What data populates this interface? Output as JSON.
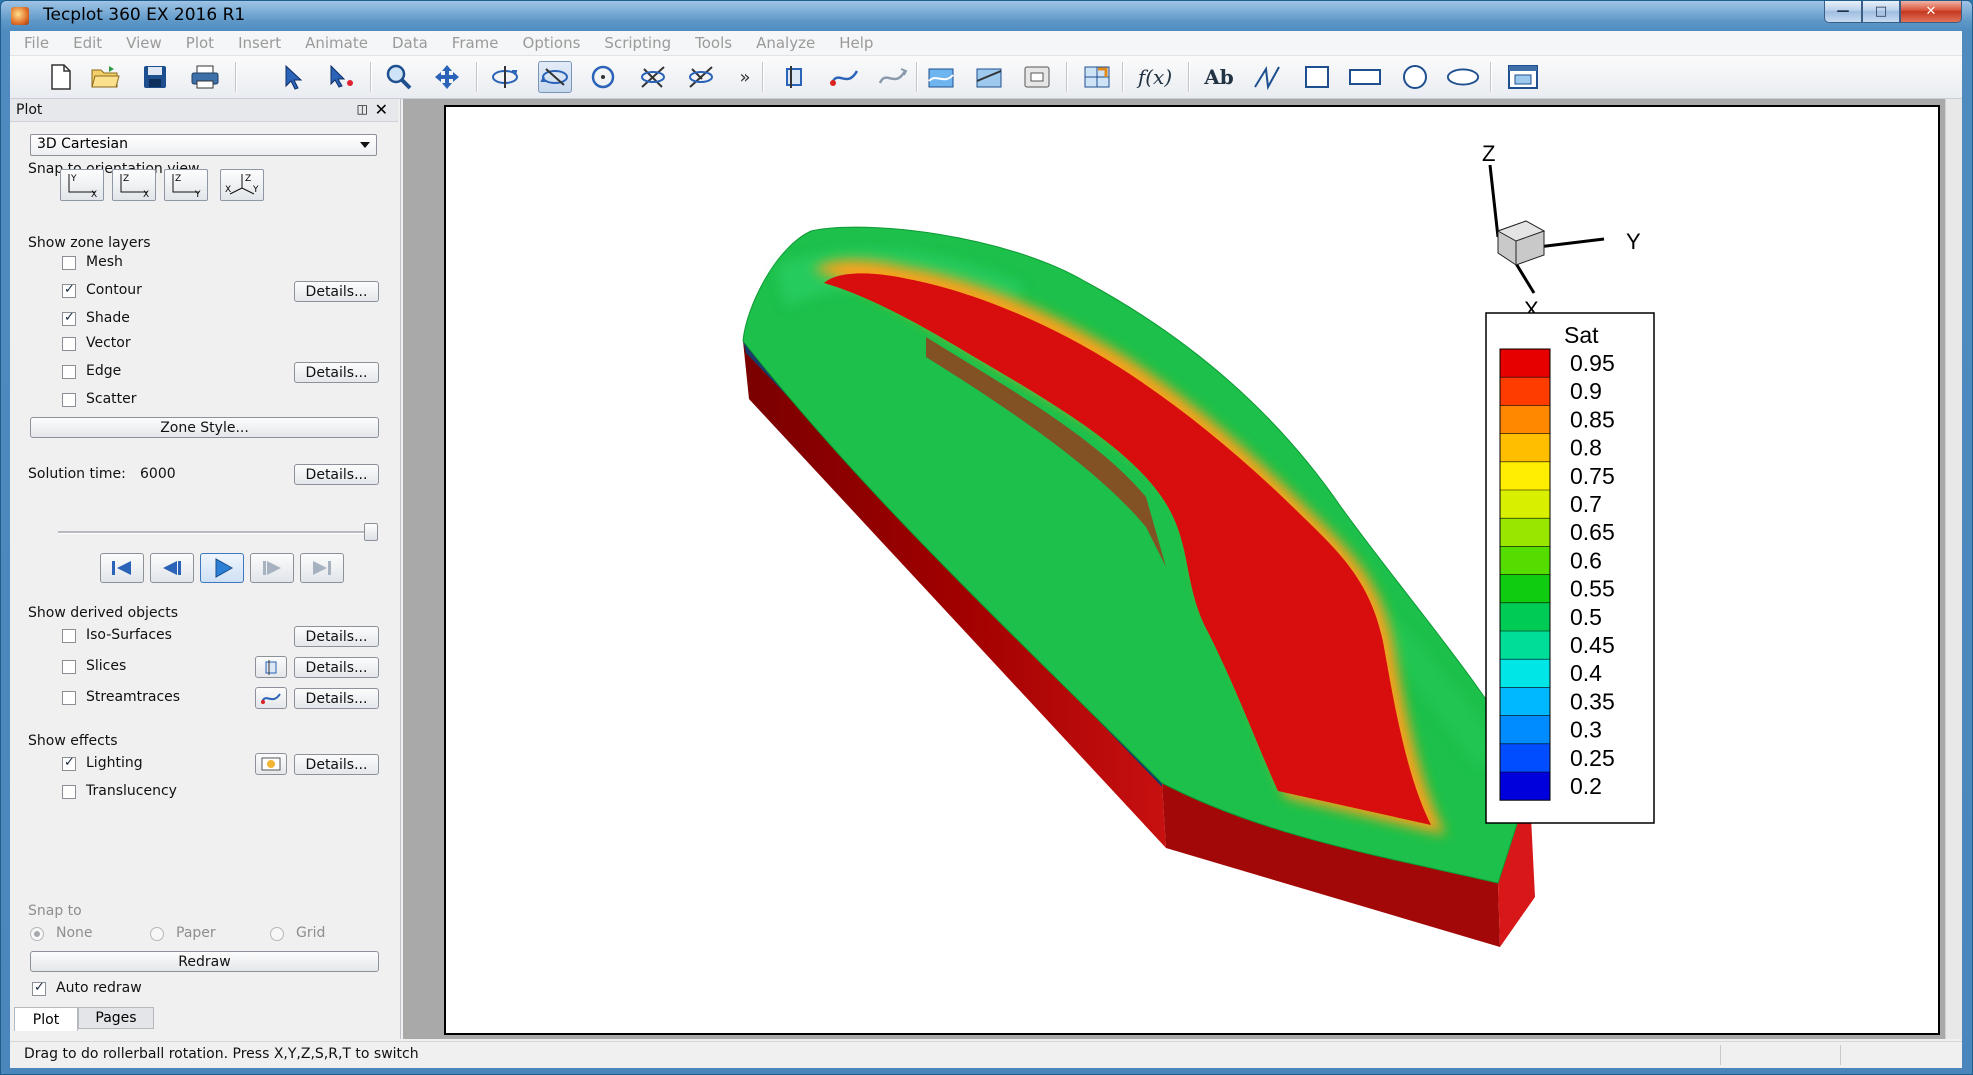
{
  "window": {
    "title": "Tecplot 360 EX 2016 R1"
  },
  "menubar": [
    "File",
    "Edit",
    "View",
    "Plot",
    "Insert",
    "Animate",
    "Data",
    "Frame",
    "Options",
    "Scripting",
    "Tools",
    "Analyze",
    "Help"
  ],
  "toolbar": {
    "overflow_label": "»",
    "text_tool_label": "Ab",
    "function_label": "f(x)"
  },
  "panel": {
    "title": "Plot",
    "plot_type": "3D Cartesian",
    "snap_orientation_label": "Snap to orientation view",
    "show_zone_layers_label": "Show zone layers",
    "layers": [
      {
        "label": "Mesh",
        "checked": false,
        "details": false
      },
      {
        "label": "Contour",
        "checked": true,
        "details": true
      },
      {
        "label": "Shade",
        "checked": true,
        "details": false
      },
      {
        "label": "Vector",
        "checked": false,
        "details": false
      },
      {
        "label": "Edge",
        "checked": false,
        "details": true
      },
      {
        "label": "Scatter",
        "checked": false,
        "details": false
      }
    ],
    "details_label": "Details...",
    "zone_style_label": "Zone Style...",
    "solution_time_label": "Solution time:",
    "solution_time_value": "6000",
    "show_derived_label": "Show derived objects",
    "derived": [
      {
        "label": "Iso-Surfaces",
        "checked": false
      },
      {
        "label": "Slices",
        "checked": false
      },
      {
        "label": "Streamtraces",
        "checked": false
      }
    ],
    "show_effects_label": "Show effects",
    "effects": [
      {
        "label": "Lighting",
        "checked": true
      },
      {
        "label": "Translucency",
        "checked": false
      }
    ],
    "snap_to_label": "Snap to",
    "snap_options": [
      "None",
      "Paper",
      "Grid"
    ],
    "redraw_label": "Redraw",
    "auto_redraw_label": "Auto redraw",
    "auto_redraw_checked": true,
    "tabs": [
      "Plot",
      "Pages"
    ]
  },
  "axes_triad": {
    "x": "X",
    "y": "Y",
    "z": "Z"
  },
  "legend": {
    "title": "Sat",
    "levels": [
      "0.95",
      "0.9",
      "0.85",
      "0.8",
      "0.75",
      "0.7",
      "0.65",
      "0.6",
      "0.55",
      "0.5",
      "0.45",
      "0.4",
      "0.35",
      "0.3",
      "0.25",
      "0.2"
    ],
    "colors": [
      "#e60000",
      "#ff3c00",
      "#ff8800",
      "#ffbf00",
      "#ffee00",
      "#d8f000",
      "#99e600",
      "#55dd00",
      "#10cc10",
      "#00cc55",
      "#00dd99",
      "#00e6e6",
      "#00b8ff",
      "#008cff",
      "#004dff",
      "#0000dd"
    ]
  },
  "status": {
    "message": "Drag to do rollerball rotation. Press X,Y,Z,S,R,T to switch"
  }
}
